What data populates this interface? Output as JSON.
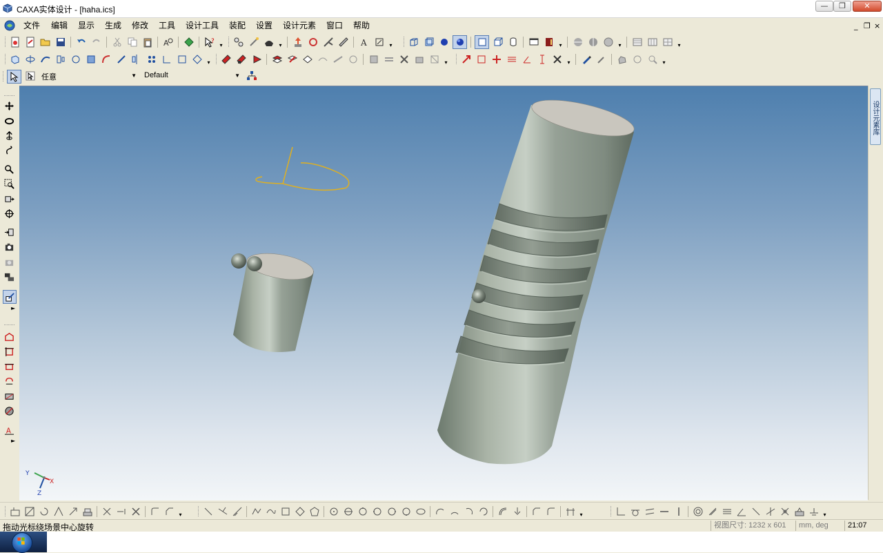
{
  "window": {
    "title": "CAXA实体设计 - [haha.ics]",
    "min_label": "—",
    "max_label": "❐",
    "close_label": "✕"
  },
  "menu": {
    "items": [
      "文件",
      "编辑",
      "显示",
      "生成",
      "修改",
      "工具",
      "设计工具",
      "装配",
      "设置",
      "设计元素",
      "窗口",
      "帮助"
    ],
    "mdi_min": "_",
    "mdi_restore": "❐",
    "mdi_close": "×"
  },
  "selection": {
    "filter_value": "任意",
    "style_value": "Default"
  },
  "right_panel": {
    "tab_label": "设计元素库"
  },
  "viewport": {
    "axis_labels": {
      "x": "X",
      "y": "Y",
      "z": "Z"
    }
  },
  "status": {
    "message": "拖动光标绕场景中心旋转",
    "view_size": "视图尺寸: 1232 x  601",
    "units": "mm, deg",
    "time": "21:07"
  },
  "colors": {
    "cylinder_body": "#9aa598",
    "cylinder_top": "#c9c6be",
    "sketch_curve": "#e0b020",
    "viewport_top": "#4e7fae",
    "viewport_bottom": "#f3f6f8"
  }
}
